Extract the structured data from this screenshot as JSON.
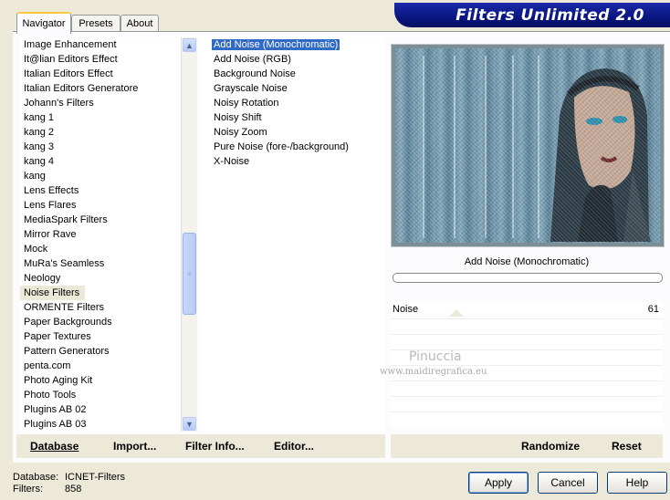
{
  "banner": {
    "title": "Filters Unlimited 2.0"
  },
  "tabs": [
    {
      "label": "Navigator",
      "active": true
    },
    {
      "label": "Presets",
      "active": false
    },
    {
      "label": "About",
      "active": false
    }
  ],
  "categories": [
    {
      "label": "Image Enhancement"
    },
    {
      "label": "It@lian Editors Effect"
    },
    {
      "label": "Italian Editors Effect"
    },
    {
      "label": "Italian Editors Generatore"
    },
    {
      "label": "Johann's Filters"
    },
    {
      "label": "kang 1"
    },
    {
      "label": "kang 2"
    },
    {
      "label": "kang 3"
    },
    {
      "label": "kang 4"
    },
    {
      "label": "kang"
    },
    {
      "label": "Lens Effects"
    },
    {
      "label": "Lens Flares"
    },
    {
      "label": "MediaSpark Filters"
    },
    {
      "label": "Mirror Rave"
    },
    {
      "label": "Mock"
    },
    {
      "label": "MuRa's Seamless"
    },
    {
      "label": "Neology"
    },
    {
      "label": "Noise Filters"
    },
    {
      "label": "ORMENTE Filters"
    },
    {
      "label": "Paper Backgrounds"
    },
    {
      "label": "Paper Textures"
    },
    {
      "label": "Pattern Generators"
    },
    {
      "label": "penta.com"
    },
    {
      "label": "Photo Aging Kit"
    },
    {
      "label": "Photo Tools"
    },
    {
      "label": "Plugins AB 02"
    },
    {
      "label": "Plugins AB 03"
    }
  ],
  "selected_category": "Noise Filters",
  "filters": [
    {
      "label": "Add Noise (Monochromatic)"
    },
    {
      "label": "Add Noise (RGB)"
    },
    {
      "label": "Background Noise"
    },
    {
      "label": "Grayscale Noise"
    },
    {
      "label": "Noisy Rotation"
    },
    {
      "label": "Noisy Shift"
    },
    {
      "label": "Noisy Zoom"
    },
    {
      "label": "Pure Noise (fore-/background)"
    },
    {
      "label": "X-Noise"
    }
  ],
  "preview": {
    "filter_name": "Add Noise (Monochromatic)"
  },
  "slider": {
    "label": "Noise",
    "value": "61"
  },
  "watermark": {
    "line1": "Pinuccia",
    "line2": "www.maidiregrafica.eu"
  },
  "left_bar": {
    "database": "Database",
    "import": "Import...",
    "filter_info": "Filter Info...",
    "editor": "Editor..."
  },
  "right_bar": {
    "randomize": "Randomize",
    "reset": "Reset"
  },
  "status": {
    "database_label": "Database:",
    "database_value": "ICNET-Filters",
    "filters_label": "Filters:",
    "filters_value": "858"
  },
  "buttons": {
    "apply": "Apply",
    "cancel": "Cancel",
    "help": "Help"
  },
  "colors": {
    "selection": "#316ac5",
    "banner": "#0a1680",
    "panel": "#ece9d8"
  }
}
